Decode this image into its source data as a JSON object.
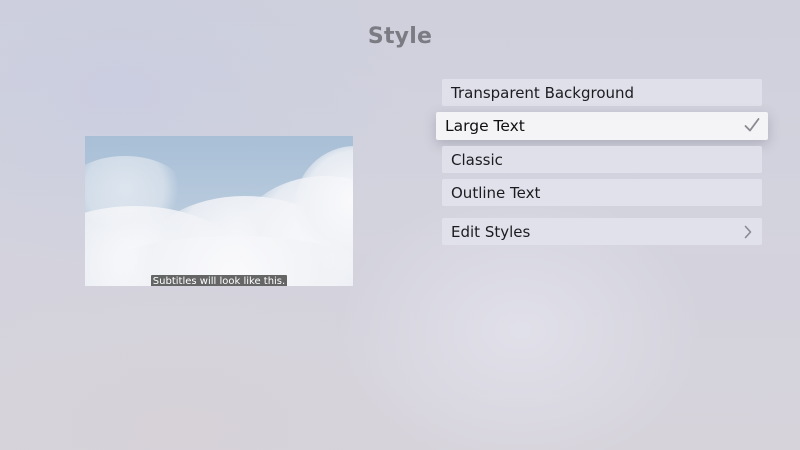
{
  "screen": {
    "title": "Style"
  },
  "preview": {
    "subtitle_text": "Subtitles will look like this."
  },
  "menu": {
    "items": [
      {
        "label": "Transparent Background",
        "selected": false
      },
      {
        "label": "Large Text",
        "selected": true,
        "icon": "checkmark-icon"
      },
      {
        "label": "Classic",
        "selected": false
      },
      {
        "label": "Outline Text",
        "selected": false
      }
    ],
    "edit": {
      "label": "Edit Styles",
      "icon": "chevron-right-icon"
    }
  }
}
